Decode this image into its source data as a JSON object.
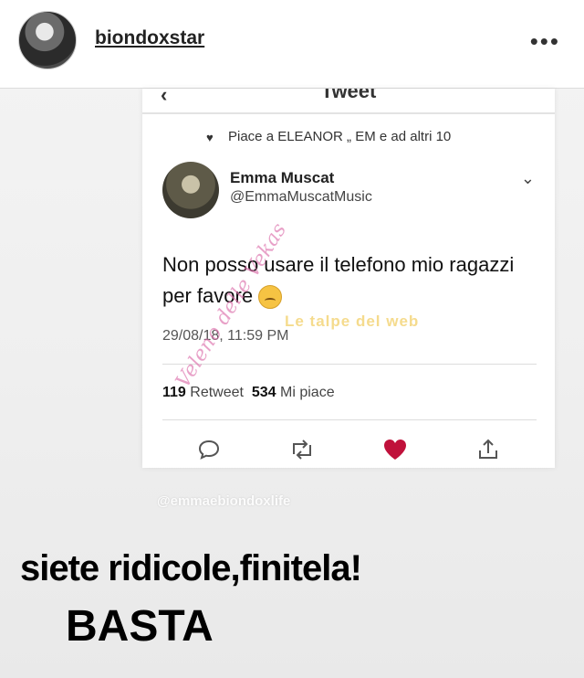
{
  "story_header": {
    "username": "biondoxstar",
    "more_icon": "•••"
  },
  "tweet": {
    "screen_title": "Tweet",
    "liked_by": "Piace a ELEANOR „ EM e ad altri 10",
    "author_name": "Emma Muscat",
    "author_handle": "@EmmaMuscatMusic",
    "text": "Non posso usare il telefono mio ragazzi per favore",
    "date": "29/08/18, 11:59 PM",
    "retweets_count": "119",
    "retweets_label": "Retweet",
    "likes_count": "534",
    "likes_label": "Mi piace",
    "like_color": "#c0113b"
  },
  "overlays": {
    "credit": "@emmaebiondoxlife",
    "watermark_script": "Veleno delle Vekas",
    "watermark_yellow": "Le talpe del web"
  },
  "captions": {
    "line1": "siete ridicole,finitela!",
    "line2": "BASTA"
  }
}
